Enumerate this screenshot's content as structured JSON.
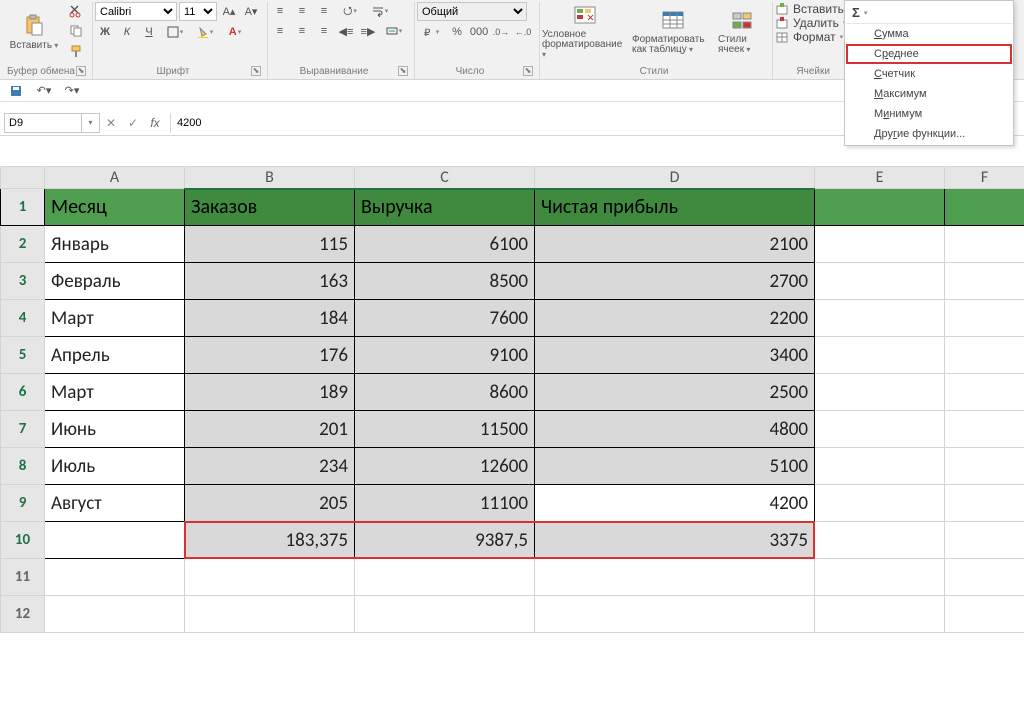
{
  "ribbon": {
    "clipboard": {
      "paste": "Вставить",
      "label": "Буфер обмена"
    },
    "font": {
      "name": "Calibri",
      "size": "11",
      "label": "Шрифт"
    },
    "alignment": {
      "label": "Выравнивание"
    },
    "number": {
      "format": "Общий",
      "label": "Число"
    },
    "styles": {
      "cond": "Условное форматирование",
      "table": "Форматировать как таблицу",
      "cell": "Стили ячеек",
      "label": "Стили"
    },
    "cells": {
      "insert": "Вставить",
      "delete": "Удалить",
      "format": "Формат",
      "label": "Ячейки"
    }
  },
  "autosum_menu": {
    "sum": "Сумма",
    "avg": "Среднее",
    "count": "Счетчик",
    "max": "Максимум",
    "min": "Минимум",
    "more": "Другие функции..."
  },
  "namebox": "D9",
  "formula": "4200",
  "columns": [
    "A",
    "B",
    "C",
    "D",
    "E",
    "F"
  ],
  "headers": {
    "A": "Месяц",
    "B": "Заказов",
    "C": "Выручка",
    "D": "Чистая прибыль"
  },
  "rows": [
    {
      "n": 2,
      "A": "Январь",
      "B": "115",
      "C": "6100",
      "D": "2100"
    },
    {
      "n": 3,
      "A": "Февраль",
      "B": "163",
      "C": "8500",
      "D": "2700"
    },
    {
      "n": 4,
      "A": "Март",
      "B": "184",
      "C": "7600",
      "D": "2200"
    },
    {
      "n": 5,
      "A": "Апрель",
      "B": "176",
      "C": "9100",
      "D": "3400"
    },
    {
      "n": 6,
      "A": "Март",
      "B": "189",
      "C": "8600",
      "D": "2500"
    },
    {
      "n": 7,
      "A": "Июнь",
      "B": "201",
      "C": "11500",
      "D": "4800"
    },
    {
      "n": 8,
      "A": "Июль",
      "B": "234",
      "C": "12600",
      "D": "5100"
    },
    {
      "n": 9,
      "A": "Август",
      "B": "205",
      "C": "11100",
      "D": "4200"
    }
  ],
  "averages": {
    "n": 10,
    "B": "183,375",
    "C": "9387,5",
    "D": "3375"
  },
  "empty_rows": [
    11,
    12
  ]
}
